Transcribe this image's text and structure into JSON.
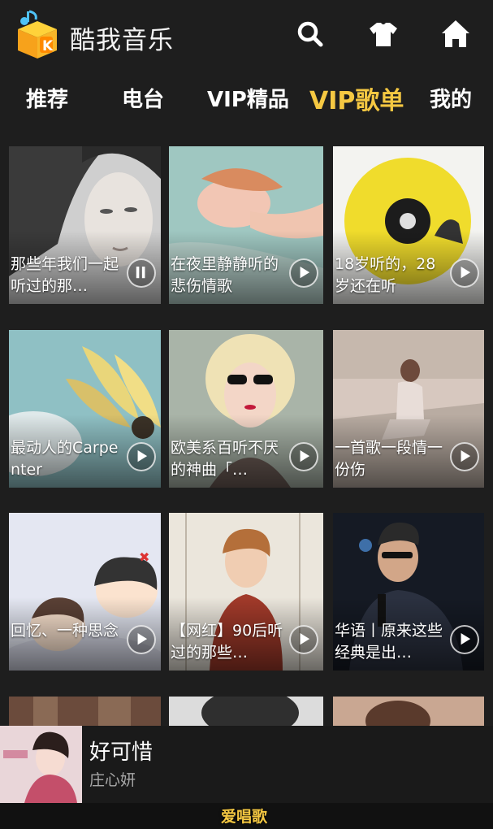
{
  "app": {
    "title": "酷我音乐",
    "logo_icon": "kuwo-cube-logo",
    "accent": "#f5c842"
  },
  "header": {
    "search_icon": "search-icon",
    "skin_icon": "tshirt-icon",
    "home_icon": "home-icon"
  },
  "tabs": [
    {
      "label": "推荐"
    },
    {
      "label": "电台"
    },
    {
      "label": "VIP精品"
    },
    {
      "label": "VIP歌单",
      "active": true
    },
    {
      "label": "我的"
    }
  ],
  "playlists": [
    {
      "title": "那些年我们一起听过的那…",
      "state": "pause"
    },
    {
      "title": "在夜里静静听的悲伤情歌",
      "state": "play"
    },
    {
      "title": "18岁听的，28岁还在听",
      "state": "play"
    },
    {
      "title": "最动人的Carpenter",
      "state": "play"
    },
    {
      "title": "欧美系百听不厌的神曲「…",
      "state": "play"
    },
    {
      "title": "一首歌一段情一份伤",
      "state": "play"
    },
    {
      "title": "回忆、一种思念",
      "state": "play"
    },
    {
      "title": "【网红】90后听过的那些…",
      "state": "play"
    },
    {
      "title": "华语丨原来这些经典是出…",
      "state": "play"
    }
  ],
  "now_playing": {
    "song": "好可惜",
    "artist": "庄心妍"
  },
  "watermark": "爱唱歌"
}
